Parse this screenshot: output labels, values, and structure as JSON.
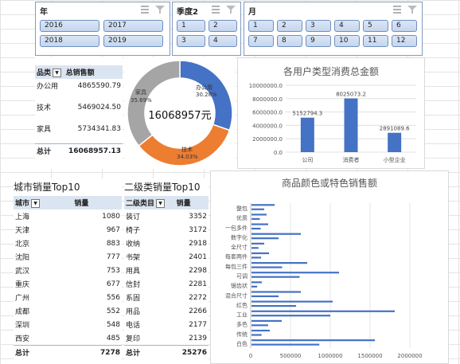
{
  "slicers": {
    "year": {
      "title": "年",
      "items": [
        "2016",
        "2017",
        "2018",
        "2019"
      ]
    },
    "quarter": {
      "title": "季度2",
      "items": [
        "1",
        "2",
        "3",
        "4"
      ]
    },
    "month": {
      "title": "月",
      "items": [
        "1",
        "2",
        "3",
        "4",
        "5",
        "6",
        "7",
        "8",
        "9",
        "10",
        "11",
        "12"
      ]
    }
  },
  "category_table": {
    "headers": [
      "品类",
      "总销售额"
    ],
    "rows": [
      {
        "label": "办公用",
        "value": "4865590.79"
      },
      {
        "label": "技术",
        "value": "5469024.50"
      },
      {
        "label": "家具",
        "value": "5734341.83"
      }
    ],
    "total_label": "总计",
    "total_value": "16068957.13"
  },
  "donut": {
    "center_label": "16068957元",
    "slices": [
      {
        "name": "办公用",
        "pct_label": "30.28%",
        "value": 30.28,
        "color": "#4472c4"
      },
      {
        "name": "技术",
        "pct_label": "34.03%",
        "value": 34.03,
        "color": "#ed7d31"
      },
      {
        "name": "家具",
        "pct_label": "35.69%",
        "value": 35.69,
        "color": "#a5a5a5"
      }
    ]
  },
  "user_chart": {
    "title": "各用户类型消费总金额",
    "y_ticks": [
      "10000000.0",
      "8000000.0",
      "6000000.0",
      "4000000.0",
      "2000000.0",
      "0.0"
    ],
    "ymax": 10000000,
    "categories": [
      "公司",
      "消费者",
      "小型企业"
    ],
    "values": [
      5152794.3,
      8025073.2,
      2891089.6
    ],
    "value_labels": [
      "5152794.3",
      "8025073.2",
      "2891089.6"
    ],
    "color": "#4472c4"
  },
  "city_table": {
    "title": "城市销量Top10",
    "headers": [
      "城市",
      "销量"
    ],
    "rows": [
      {
        "label": "上海",
        "value": "1080"
      },
      {
        "label": "天津",
        "value": "967"
      },
      {
        "label": "北京",
        "value": "883"
      },
      {
        "label": "沈阳",
        "value": "777"
      },
      {
        "label": "武汉",
        "value": "753"
      },
      {
        "label": "重庆",
        "value": "677"
      },
      {
        "label": "广州",
        "value": "556"
      },
      {
        "label": "成都",
        "value": "552"
      },
      {
        "label": "深圳",
        "value": "548"
      },
      {
        "label": "西安",
        "value": "485"
      }
    ],
    "total_label": "总计",
    "total_value": "7278"
  },
  "subcat_table": {
    "title": "二级类销量Top10",
    "headers": [
      "二级类目",
      "销量"
    ],
    "rows": [
      {
        "label": "装订",
        "value": "3352"
      },
      {
        "label": "椅子",
        "value": "3172"
      },
      {
        "label": "收纳",
        "value": "2918"
      },
      {
        "label": "书架",
        "value": "2401"
      },
      {
        "label": "用具",
        "value": "2298"
      },
      {
        "label": "信封",
        "value": "2281"
      },
      {
        "label": "系固",
        "value": "2272"
      },
      {
        "label": "用品",
        "value": "2266"
      },
      {
        "label": "电话",
        "value": "2177"
      },
      {
        "label": "复印",
        "value": "2139"
      }
    ],
    "total_label": "总计",
    "total_value": "25276"
  },
  "chart_data": {
    "type": "bar",
    "orientation": "horizontal",
    "title": "商品颜色或特色销售额",
    "categories": [
      "整包",
      "优质",
      "一包多件",
      "数字化",
      "全尺寸",
      "每套两件",
      "每包三件",
      "可调",
      "锯齿状",
      "混合尺寸",
      "红色",
      "工业",
      "多色",
      "传统",
      "白色"
    ],
    "series": [
      {
        "values": [
          290000,
          190000,
          210000,
          620000,
          160000,
          220000,
          700000,
          1100000,
          130000,
          620000,
          1020000,
          1800000,
          380000,
          230000,
          1550000
        ]
      }
    ],
    "x_ticks": [
      "0",
      "500000",
      "1000000",
      "1500000",
      "2000000"
    ],
    "xlim": [
      0,
      2000000
    ],
    "color": "#4472c4"
  }
}
